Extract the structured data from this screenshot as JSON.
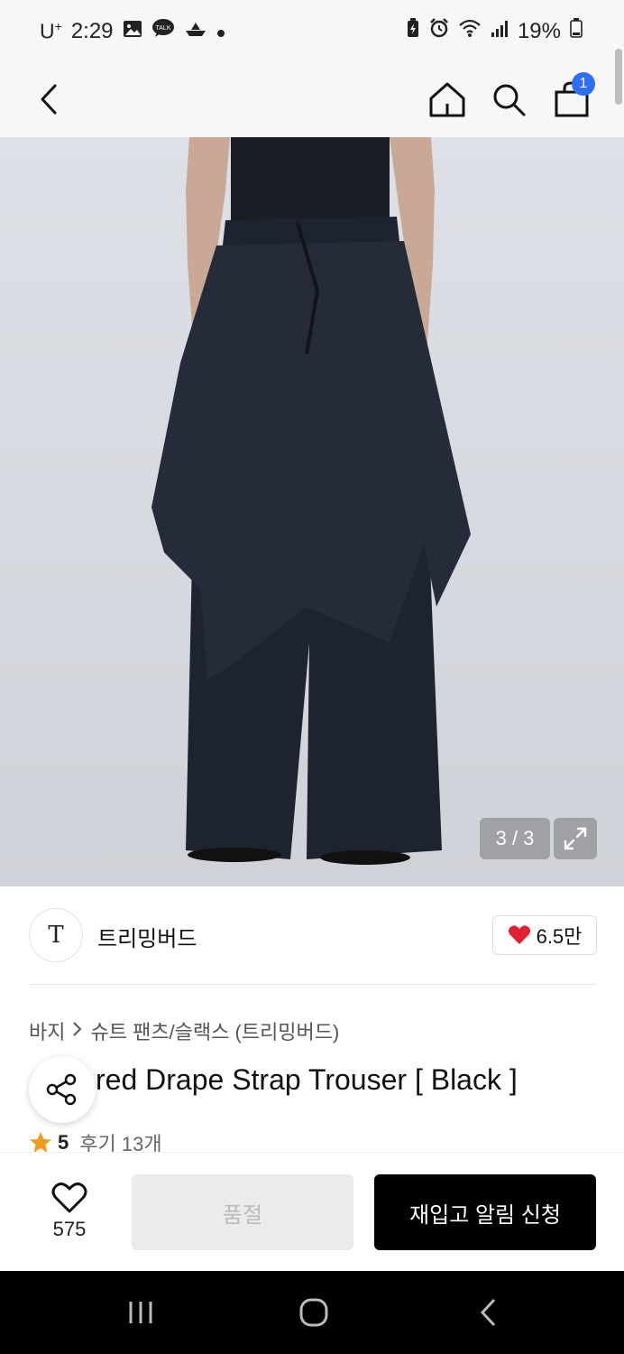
{
  "status_bar": {
    "carrier": "U",
    "carrier_sup": "+",
    "time": "2:29",
    "battery": "19%",
    "icons": [
      "gallery-icon",
      "talk-icon",
      "boat-icon",
      "dot-icon",
      "battery-saver-icon",
      "alarm-icon",
      "wifi-icon",
      "signal-icon",
      "battery-icon"
    ]
  },
  "header": {
    "back_icon": "chevron-left-icon",
    "home_icon": "home-icon",
    "search_icon": "search-icon",
    "cart_icon": "shopping-bag-icon",
    "cart_badge": "1"
  },
  "gallery": {
    "counter": "3 / 3",
    "expand_icon": "expand-icon"
  },
  "brand": {
    "logo_text": "T",
    "name": "트리밍버드",
    "likes": "6.5만"
  },
  "product": {
    "category_parent": "바지",
    "category_child": "슈트 팬츠/슬랙스 (트리밍버드)",
    "title_visible": "red Drape Strap Trouser [ Black ]",
    "rating": "5",
    "review_label": "후기 13개"
  },
  "actions": {
    "wish_count": "575",
    "soldout_label": "품절",
    "restock_label": "재입고 알림 신청"
  },
  "colors": {
    "accent_blue": "#2f6ef0",
    "heart_red": "#e0202e",
    "star_orange": "#f29a1e",
    "primary_black": "#000000"
  }
}
